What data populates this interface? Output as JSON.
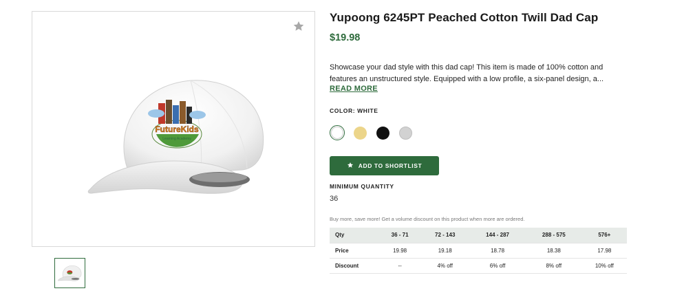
{
  "product": {
    "title": "Yupoong 6245PT Peached Cotton Twill Dad Cap",
    "price": "$19.98",
    "description": "Showcase your dad style with this dad cap! This item is made of 100% cotton and features an unstructured style. Equipped with a low profile, a six-panel design, a...",
    "read_more": "READ MORE"
  },
  "gallery": {
    "image_alt": "White dad cap with Future Kids Learning Academy logo",
    "logo_text": "FutureKids",
    "logo_subtext": "Learning Academy"
  },
  "color": {
    "label": "COLOR: WHITE",
    "swatches": [
      {
        "name": "White",
        "hex": "#ffffff",
        "selected": true
      },
      {
        "name": "Khaki",
        "hex": "#ecd58a",
        "selected": false
      },
      {
        "name": "Black",
        "hex": "#111111",
        "selected": false
      },
      {
        "name": "Grey",
        "hex": "#d2d2d2",
        "selected": false
      }
    ]
  },
  "shortlist": {
    "label": "ADD TO SHORTLIST",
    "icon": "star-icon"
  },
  "minimum_quantity": {
    "label": "MINIMUM QUANTITY",
    "value": "36"
  },
  "volume_note": "Buy more, save more! Get a volume discount on this product when more are ordered.",
  "pricing_table": {
    "header": {
      "label": "Qty",
      "cells": [
        "36 - 71",
        "72 - 143",
        "144 - 287",
        "288 - 575",
        "576+"
      ]
    },
    "rows": [
      {
        "label": "Price",
        "cells": [
          "19.98",
          "19.18",
          "18.78",
          "18.38",
          "17.98"
        ]
      },
      {
        "label": "Discount",
        "cells": [
          "--",
          "4% off",
          "6% off",
          "8% off",
          "10% off"
        ]
      }
    ]
  },
  "colors": {
    "accent": "#2e6b3c",
    "table_header_bg": "#e7ebe8"
  }
}
